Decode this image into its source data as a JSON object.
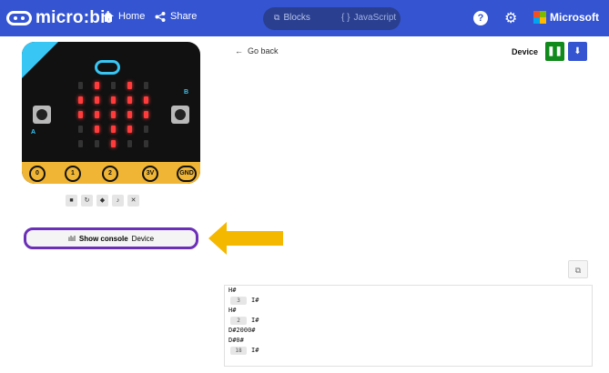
{
  "header": {
    "brand": "micro:bit",
    "home_label": "Home",
    "share_label": "Share",
    "blocks_label": "Blocks",
    "javascript_label": "JavaScript",
    "help_glyph": "?",
    "microsoft_label": "Microsoft"
  },
  "simulator": {
    "pin_labels": [
      "0",
      "1",
      "2",
      "3V",
      "GND"
    ],
    "button_a": "A",
    "button_b": "B",
    "controls": [
      "stop-icon",
      "restart-icon",
      "slowmo-icon",
      "sound-icon",
      "fullscreen-icon"
    ],
    "led_matrix": [
      [
        0,
        1,
        0,
        1,
        0
      ],
      [
        1,
        1,
        1,
        1,
        1
      ],
      [
        1,
        1,
        1,
        1,
        1
      ],
      [
        0,
        1,
        1,
        1,
        0
      ],
      [
        0,
        0,
        1,
        0,
        0
      ]
    ],
    "led_on_color": "#ff3b3b",
    "led_off_color": "#333333",
    "board_color": "#111111",
    "edge_color": "#f0b534"
  },
  "console_toggle": {
    "label": "Show console",
    "sub_label": "Device"
  },
  "main": {
    "go_back_label": "Go back",
    "device_label": "Device",
    "pause_icon": "pause-icon",
    "download_icon": "download-icon",
    "copy_icon": "copy-icon"
  },
  "console_lines": [
    {
      "text": "H#"
    },
    {
      "count": "3",
      "text": "I#"
    },
    {
      "text": "H#"
    },
    {
      "count": "2",
      "text": "I#"
    },
    {
      "text": "D#2000#"
    },
    {
      "text": "D#0#"
    },
    {
      "count": "18",
      "text": "I#"
    }
  ],
  "colors": {
    "topbar": "#3454d1",
    "accent_purple": "#6b2fb8",
    "arrow": "#f5b800",
    "pause_green": "#108a1a"
  }
}
